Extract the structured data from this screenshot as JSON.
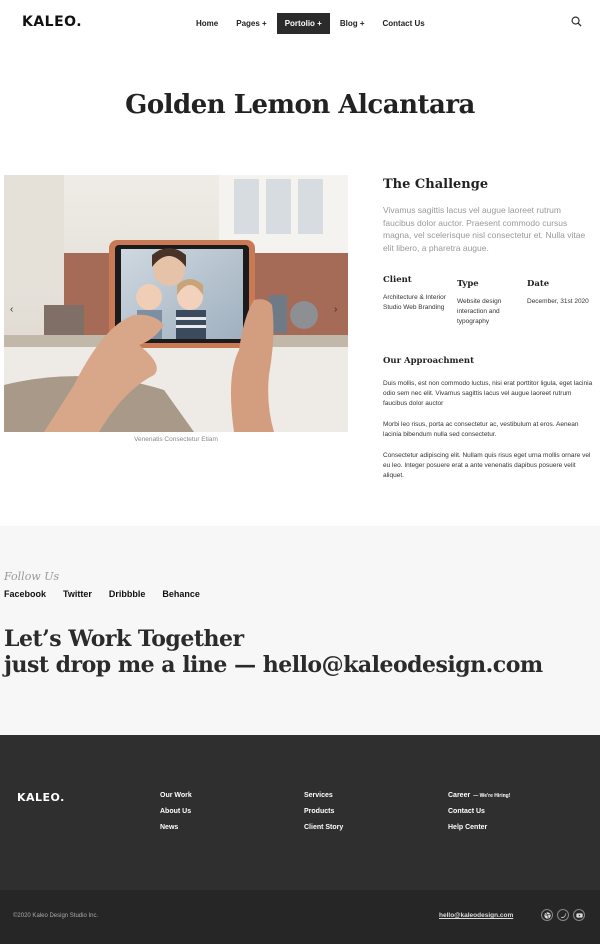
{
  "header": {
    "logo": "KALEO.",
    "nav": [
      {
        "label": "Home"
      },
      {
        "label": "Pages +"
      },
      {
        "label": "Portolio +"
      },
      {
        "label": "Blog +"
      },
      {
        "label": "Contact Us"
      }
    ],
    "active_nav": "Portolio +"
  },
  "page": {
    "title": "Golden Lemon Alcantara",
    "image_caption": "Venenatis Consectetur Etiam"
  },
  "challenge": {
    "title": "The Challenge",
    "text": "Vivamus sagittis lacus vel augue laoreet rutrum faucibus dolor auctor. Praesent commodo cursus magna, vel scelerisque nisl consectetur et. Nulla vitae elit libero, a pharetra augue."
  },
  "meta": {
    "client_label": "Client",
    "client_value": "Architecture & Interior Studio Web Branding",
    "type_label": "Type",
    "type_value": "Website design interaction and typography",
    "date_label": "Date",
    "date_value": "December, 31st 2020"
  },
  "approach": {
    "title": "Our Approachment",
    "paragraphs": [
      "Duis mollis, est non commodo luctus, nisi erat porttitor ligula, eget lacinia odio sem nec elit. Vivamus sagittis lacus vel augue laoreet rutrum faucibus dolor auctor",
      "Morbi leo risus, porta ac consectetur ac, vestibulum at eros. Aenean lacinia bibendum nulla sed consectetur.",
      "Consectetur adipiscing elit. Nullam quis risus eget urna mollis ornare vel eu leo. Integer posuere erat a ante venenatis dapibus posuere velit aliquet."
    ]
  },
  "follow": {
    "label": "Follow Us",
    "links": [
      "Facebook",
      "Twitter",
      "Dribbble",
      "Behance"
    ],
    "cta_line1": "Let’s Work Together",
    "cta_line2": "just drop me a line —  hello@kaleodesign.com"
  },
  "footer": {
    "logo": "KALEO.",
    "col1": [
      "Our Work",
      "About Us",
      "News"
    ],
    "col2": [
      "Services",
      "Products",
      "Client Story"
    ],
    "col3": [
      "Career",
      "Contact Us",
      "Help Center"
    ],
    "hiring": "— We're Hiring!",
    "copyright": "©2020 Kaleo Design Studio Inc.",
    "email": "hello@kaleodesign.com",
    "icons": [
      "dribbble-icon",
      "twitter-icon",
      "youtube-icon"
    ]
  }
}
